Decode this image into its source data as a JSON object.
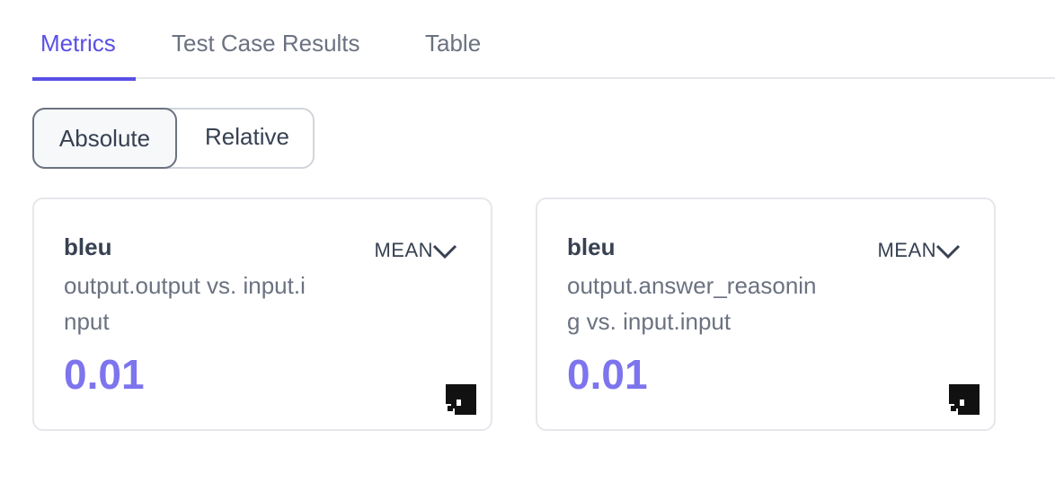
{
  "tabs": [
    {
      "label": "Metrics",
      "active": true
    },
    {
      "label": "Test Case Results",
      "active": false
    },
    {
      "label": "Table",
      "active": false
    }
  ],
  "toggle": {
    "options": [
      "Absolute",
      "Relative"
    ],
    "selected": "Absolute"
  },
  "cards": [
    {
      "name": "bleu",
      "description": "output.output vs. input.input",
      "aggregation": "MEAN",
      "value": "0.01"
    },
    {
      "name": "bleu",
      "description": "output.answer_reasoning vs. input.input",
      "aggregation": "MEAN",
      "value": "0.01"
    }
  ],
  "colors": {
    "accent": "#5a4fe6",
    "value": "#7d74ee",
    "muted": "#6b7280",
    "text": "#374151"
  },
  "icons": {
    "aggregation_dropdown": "chevron-down-icon",
    "brand": "logo-icon"
  }
}
